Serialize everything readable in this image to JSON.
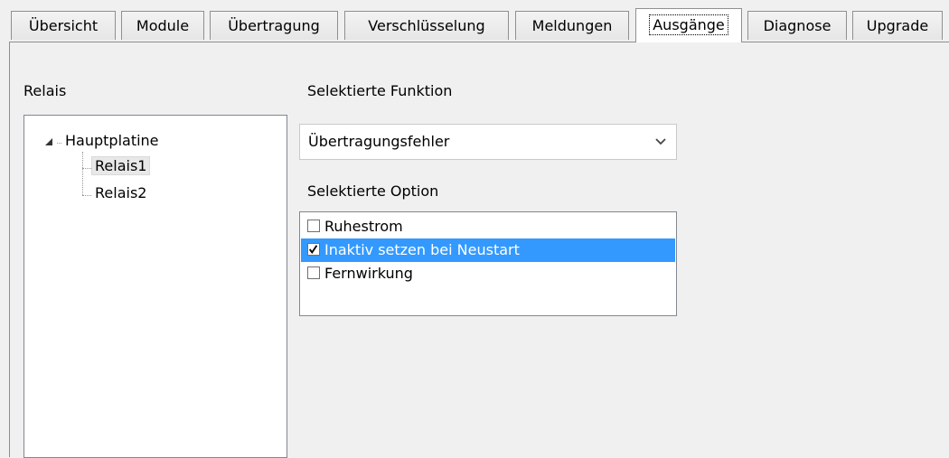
{
  "tabs": [
    {
      "label": "Übersicht"
    },
    {
      "label": "Module"
    },
    {
      "label": "Übertragung"
    },
    {
      "label": "Verschlüsselung"
    },
    {
      "label": "Meldungen"
    },
    {
      "label": "Ausgänge"
    },
    {
      "label": "Diagnose"
    },
    {
      "label": "Upgrade"
    }
  ],
  "active_tab": "Ausgänge",
  "relais": {
    "label": "Relais",
    "tree": {
      "root": "Hauptplatine",
      "children": [
        "Relais1",
        "Relais2"
      ],
      "selected": "Relais1"
    }
  },
  "function": {
    "label": "Selektierte Funktion",
    "value": "Übertragungsfehler"
  },
  "option": {
    "label": "Selektierte Option",
    "items": [
      {
        "label": "Ruhestrom",
        "checked": false,
        "selected": false
      },
      {
        "label": "Inaktiv setzen bei Neustart",
        "checked": true,
        "selected": true
      },
      {
        "label": "Fernwirkung",
        "checked": false,
        "selected": false
      }
    ]
  },
  "colors": {
    "selection": "#3399ff",
    "window_bg": "#f0f0f0",
    "border": "#8e8f8f"
  }
}
